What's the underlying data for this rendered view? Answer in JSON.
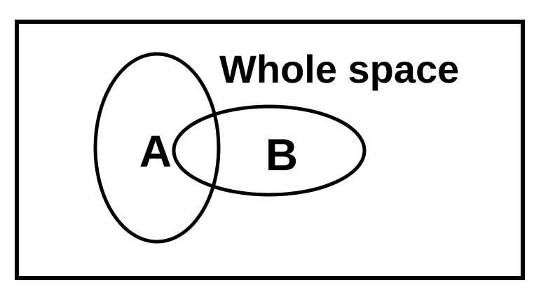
{
  "diagram": {
    "whole_space_label": "Whole space",
    "set_a_label": "A",
    "set_b_label": "B"
  },
  "colors": {
    "stroke": "#000000",
    "background": "#ffffff"
  }
}
